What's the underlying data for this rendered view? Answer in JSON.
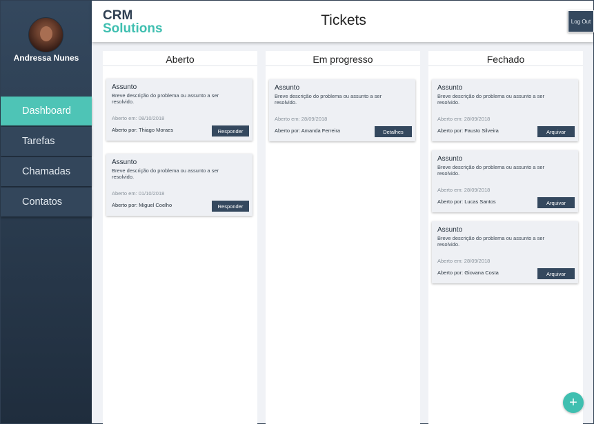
{
  "user": {
    "name": "Andressa Nunes"
  },
  "sidebar": {
    "items": [
      {
        "label": "Dashboard",
        "active": true
      },
      {
        "label": "Tarefas"
      },
      {
        "label": "Chamadas"
      },
      {
        "label": "Contatos"
      }
    ]
  },
  "header": {
    "brand_line1": "CRM",
    "brand_line2": "Solutions",
    "title": "Tickets",
    "logout_label": "Log Out"
  },
  "columns": [
    {
      "title": "Aberto",
      "cards": [
        {
          "subject": "Assunto",
          "description": "Breve descrição do problema ou assunto a ser resolvido.",
          "date": "Aberto em: 08/10/2018",
          "by": "Aberto por: Thiago Moraes",
          "action": "Responder"
        },
        {
          "subject": "Assunto",
          "description": "Breve descrição do problema ou assunto a ser resolvido.",
          "date": "Aberto em: 01/10/2018",
          "by": "Aberto por: Miguel Coelho",
          "action": "Responder"
        }
      ]
    },
    {
      "title": "Em progresso",
      "cards": [
        {
          "subject": "Assunto",
          "description": "Breve descrição do problema ou assunto a ser resolvido.",
          "date": "Aberto em: 28/09/2018",
          "by": "Aberto por: Amanda Ferreira",
          "action": "Detalhes"
        }
      ]
    },
    {
      "title": "Fechado",
      "cards": [
        {
          "subject": "Assunto",
          "description": "Breve descrição do problema ou assunto a ser resolvido.",
          "date": "Aberto em: 28/09/2018",
          "by": "Aberto por: Fausto Silveira",
          "action": "Arquivar"
        },
        {
          "subject": "Assunto",
          "description": "Breve descrição do problema ou assunto a ser resolvido.",
          "date": "Aberto em: 28/09/2018",
          "by": "Aberto por: Lucas Santos",
          "action": "Arquivar"
        },
        {
          "subject": "Assunto",
          "description": "Breve descrição do problema ou assunto a ser resolvido.",
          "date": "Aberto em: 28/09/2018",
          "by": "Aberto por: Giovana Costa",
          "action": "Arquivar"
        }
      ]
    }
  ],
  "fab": {
    "icon": "plus-icon",
    "glyph": "+"
  },
  "colors": {
    "sidebar": "#2f4156",
    "accent": "#3fbfb0",
    "button": "#34485e",
    "card": "#eef0f4"
  }
}
